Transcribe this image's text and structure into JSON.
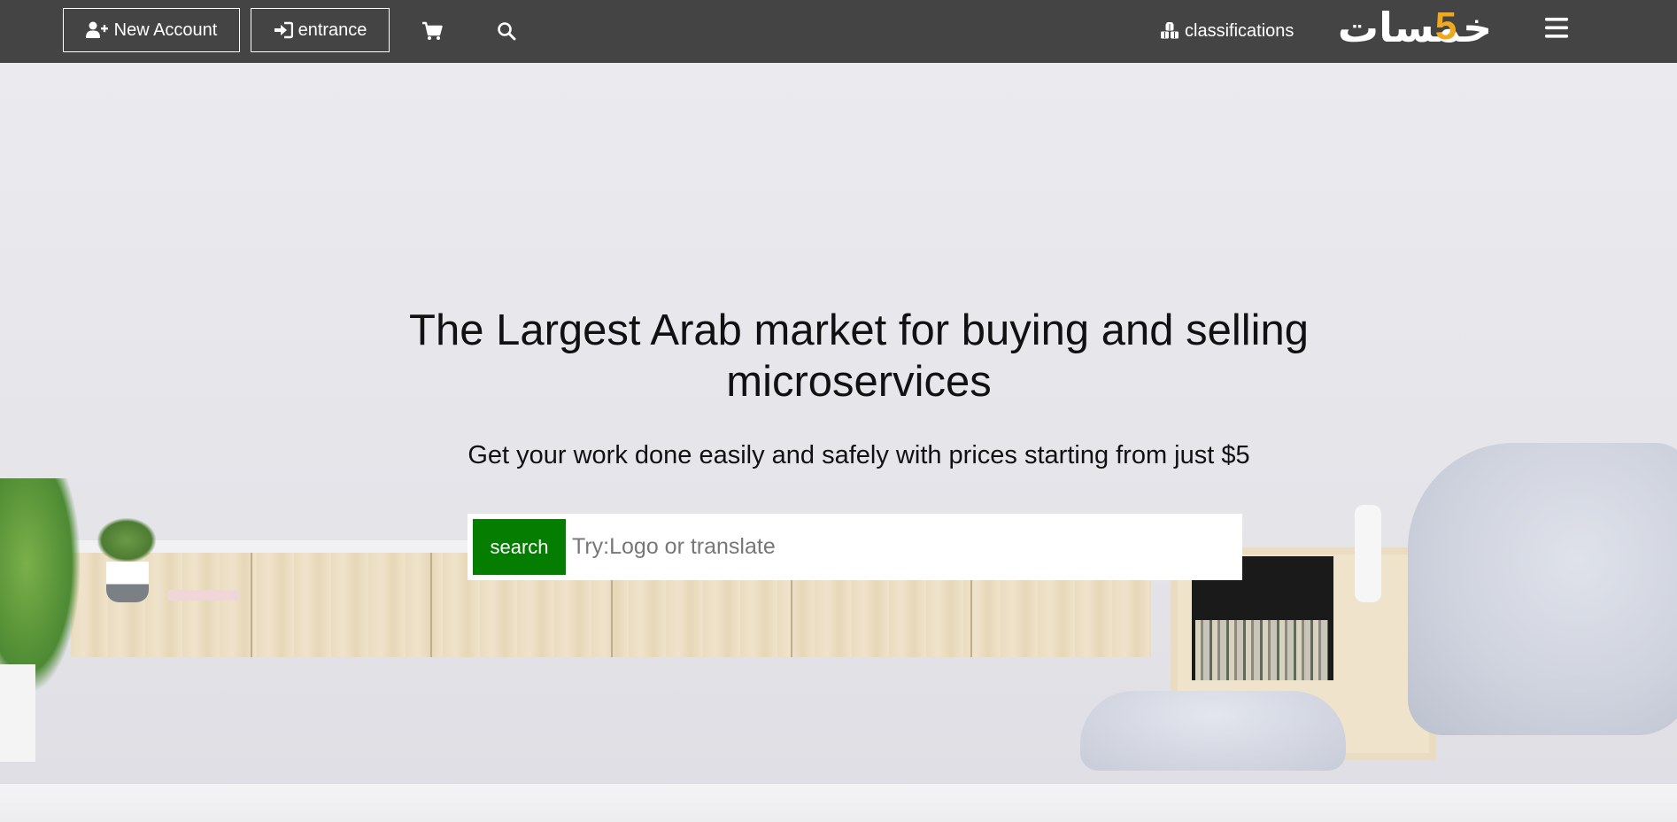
{
  "header": {
    "new_account_label": "New Account",
    "entrance_label": "entrance",
    "classifications_label": "classifications",
    "icons": {
      "new_account": "user-plus-icon",
      "entrance": "sign-in-icon",
      "cart": "cart-icon",
      "search": "search-icon",
      "classifications": "cubes-icon",
      "menu": "hamburger-icon"
    },
    "logo_text": "خمسات",
    "logo_digit": "5"
  },
  "hero": {
    "title": "The Largest Arab market for buying and selling microservices",
    "subtitle": "Get your work done easily and safely with prices starting from just $5",
    "search_button_label": "search",
    "search_placeholder": "Try:Logo or translate"
  },
  "colors": {
    "header_bg": "#444444",
    "accent_green": "#057d00",
    "logo_accent": "#f0a81c"
  }
}
